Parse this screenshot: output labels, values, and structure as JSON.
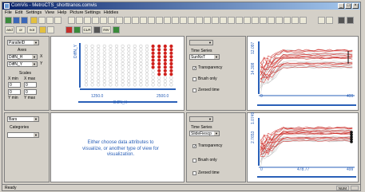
{
  "window": {
    "title": "ComVis - MetroCTS_shorttranos.comvis"
  },
  "menu": [
    "File",
    "Edit",
    "Settings",
    "View",
    "Help",
    "Picture Settings",
    "Hiddies"
  ],
  "panels": {
    "scatter_control": {
      "view_type": "ParallelD",
      "axes_label": "Axes",
      "x_attr": "DiffN_H",
      "y_attr": "DiffN_Y",
      "x_btn": "X",
      "y_btn": "Y",
      "scales_label": "Scales",
      "xmin_label": "X min",
      "xmax_label": "X max",
      "ymin_label": "Y min",
      "ymax_label": "Y max",
      "xmin": "0",
      "xmax": "0",
      "ymin": "0",
      "ymax": "0"
    },
    "scatter_plot": {
      "x_axis_title": "DiffN_H",
      "y_axis_title": "DiffN_Y",
      "x_tick_left": "1250.0",
      "x_tick_right": "2500.0"
    },
    "bar_control": {
      "view_type": "Bars",
      "categories_label": "Categories"
    },
    "empty_view": {
      "message": "Either choose data attributes to visualize, or another type of view for visualization."
    },
    "ts_top_control": {
      "time_series_label": "Time Series",
      "series": "SunNxT",
      "transparency": "Transparency",
      "brush_only": "Brush only",
      "zeroed_time": "Zeroed time",
      "transparency_checked": true
    },
    "ts_top_plot": {
      "y_top": "14.308",
      "y_bottom": "12.097",
      "x_left": "0",
      "x_right": "499"
    },
    "ts_bottom_control": {
      "time_series_label": "Time Series",
      "series": "SlideFiescp",
      "transparency": "Transparency",
      "brush_only": "Brush only",
      "zeroed_time": "Zeroed time",
      "transparency_checked": true
    },
    "ts_bottom_plot": {
      "y_top": "2.7653",
      "y_bottom": "1.0749",
      "x_left": "0",
      "x_mid": "478.77",
      "x_right": "499"
    }
  },
  "status": {
    "left": "Ready",
    "right": [
      "NUM",
      ""
    ]
  },
  "colors": {
    "brush": "#d0201c",
    "context": "#b8b8b8",
    "axis": "#2a60b8"
  }
}
